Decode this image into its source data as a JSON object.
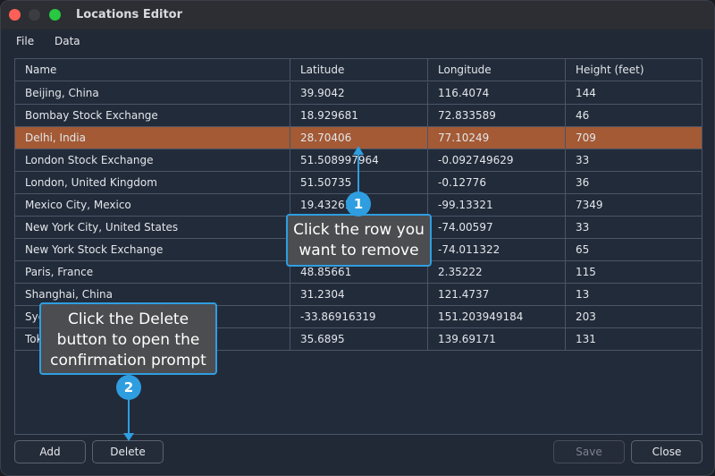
{
  "window": {
    "title": "Locations Editor"
  },
  "menu": {
    "file": "File",
    "data": "Data"
  },
  "table": {
    "columns": [
      "Name",
      "Latitude",
      "Longitude",
      "Height (feet)"
    ],
    "rows": [
      [
        "Beijing, China",
        "39.9042",
        "116.4074",
        "144"
      ],
      [
        "Bombay Stock Exchange",
        "18.929681",
        "72.833589",
        "46"
      ],
      [
        "Delhi, India",
        "28.70406",
        "77.10249",
        "709"
      ],
      [
        "London Stock Exchange",
        "51.508997964",
        "-0.092749629",
        "33"
      ],
      [
        "London, United Kingdom",
        "51.50735",
        "-0.12776",
        "36"
      ],
      [
        "Mexico City, Mexico",
        "19.43261",
        "-99.13321",
        "7349"
      ],
      [
        "New York City, United States",
        "",
        "-74.00597",
        "33"
      ],
      [
        "New York Stock Exchange",
        "",
        "-74.011322",
        "65"
      ],
      [
        "Paris, France",
        "48.85661",
        "2.35222",
        "115"
      ],
      [
        "Shanghai, China",
        "31.2304",
        "121.4737",
        "13"
      ],
      [
        "Syd",
        "-33.86916319",
        "151.203949184",
        "203"
      ],
      [
        "Tok",
        "35.6895",
        "139.69171",
        "131"
      ]
    ],
    "selected_row_index": 2,
    "selection_color": "#a35a35"
  },
  "buttons": {
    "add": "Add",
    "delete": "Delete",
    "save": "Save",
    "close": "Close"
  },
  "callouts": [
    {
      "number": "1",
      "lines": [
        "Click the row you",
        "want to remove"
      ]
    },
    {
      "number": "2",
      "lines": [
        "Click the Delete",
        "button to open the",
        "confirmation prompt"
      ]
    }
  ],
  "colors": {
    "accent": "#2f9ee0",
    "callout_bg": "#4c4d50"
  }
}
